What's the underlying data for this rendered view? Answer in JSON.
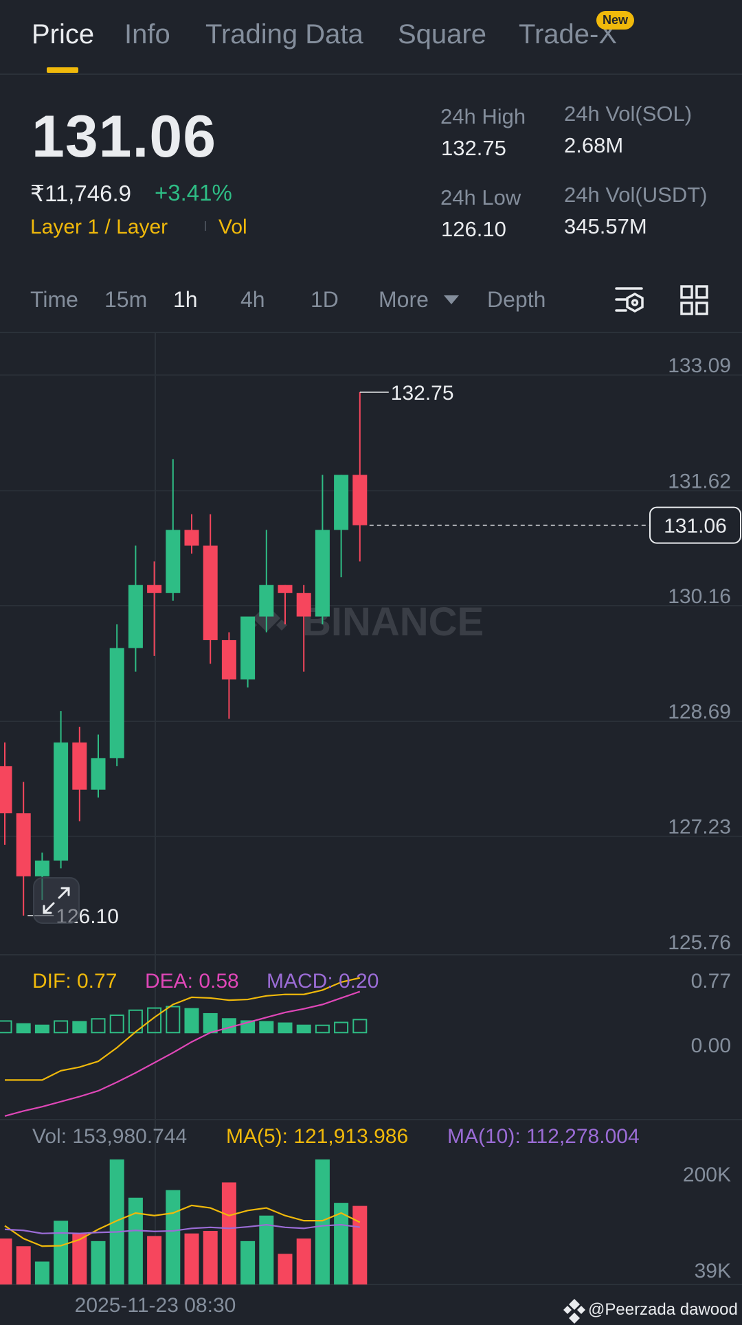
{
  "tabs": [
    {
      "label": "Price"
    },
    {
      "label": "Info"
    },
    {
      "label": "Trading Data"
    },
    {
      "label": "Square"
    },
    {
      "label": "Trade-X"
    }
  ],
  "tab_badge": "New",
  "header": {
    "last_price": "131.06",
    "fiat_price": "₹11,746.9",
    "change_pct": "+3.41%",
    "tag_primary": "Layer 1 / Layer",
    "tag_secondary": "Vol",
    "high_label": "24h High",
    "high_value": "132.75",
    "low_label": "24h Low",
    "low_value": "126.10",
    "vol_base_label": "24h Vol(SOL)",
    "vol_base_value": "2.68M",
    "vol_quote_label": "24h Vol(USDT)",
    "vol_quote_value": "345.57M"
  },
  "intervals": {
    "time": "Time",
    "m15": "15m",
    "h1": "1h",
    "h4": "4h",
    "d1": "1D",
    "more": "More",
    "depth": "Depth"
  },
  "icons": {
    "settings": "chart-settings-icon",
    "layout": "grid-layout-icon",
    "expand": "expand-icon",
    "brand": "binance-logo-icon"
  },
  "colors": {
    "up": "#2ebd85",
    "down": "#f6465d",
    "accent": "#f0b90b",
    "dea": "#e047b8",
    "ma10": "#9b6cd6"
  },
  "chart_data": {
    "type": "candlestick",
    "price_axis_ticks": [
      "133.09",
      "131.62",
      "130.16",
      "128.69",
      "127.23",
      "125.76"
    ],
    "price_ylim": [
      125.76,
      133.09
    ],
    "current_price_label": "131.06",
    "high_marker": "132.75",
    "low_marker": "126.10",
    "watermark": "BINANCE",
    "candles": [
      {
        "o": 128.0,
        "h": 128.3,
        "l": 127.0,
        "c": 127.4
      },
      {
        "o": 127.4,
        "h": 127.8,
        "l": 126.1,
        "c": 126.6
      },
      {
        "o": 126.6,
        "h": 126.9,
        "l": 126.3,
        "c": 126.8
      },
      {
        "o": 126.8,
        "h": 128.7,
        "l": 126.7,
        "c": 128.3
      },
      {
        "o": 128.3,
        "h": 128.5,
        "l": 127.3,
        "c": 127.7
      },
      {
        "o": 127.7,
        "h": 128.4,
        "l": 127.6,
        "c": 128.1
      },
      {
        "o": 128.1,
        "h": 129.8,
        "l": 128.0,
        "c": 129.5
      },
      {
        "o": 129.5,
        "h": 130.8,
        "l": 129.2,
        "c": 130.3
      },
      {
        "o": 130.3,
        "h": 130.6,
        "l": 129.4,
        "c": 130.2
      },
      {
        "o": 130.2,
        "h": 131.9,
        "l": 130.1,
        "c": 131.0
      },
      {
        "o": 131.0,
        "h": 131.2,
        "l": 130.7,
        "c": 130.8
      },
      {
        "o": 130.8,
        "h": 131.2,
        "l": 129.3,
        "c": 129.6
      },
      {
        "o": 129.6,
        "h": 129.7,
        "l": 128.6,
        "c": 129.1
      },
      {
        "o": 129.1,
        "h": 129.8,
        "l": 129.0,
        "c": 129.9
      },
      {
        "o": 129.9,
        "h": 131.0,
        "l": 129.7,
        "c": 130.3
      },
      {
        "o": 130.3,
        "h": 130.3,
        "l": 129.8,
        "c": 130.2
      },
      {
        "o": 130.2,
        "h": 130.3,
        "l": 129.2,
        "c": 129.9
      },
      {
        "o": 129.9,
        "h": 131.7,
        "l": 129.8,
        "c": 131.0
      },
      {
        "o": 131.0,
        "h": 131.7,
        "l": 130.4,
        "c": 131.7
      },
      {
        "o": 131.7,
        "h": 132.75,
        "l": 130.6,
        "c": 131.06
      }
    ],
    "macd": {
      "dif_label": "DIF: 0.77",
      "dea_label": "DEA: 0.58",
      "macd_label": "MACD: 0.20",
      "axis_ticks": [
        "0.77",
        "0.00"
      ],
      "ylim": [
        -1.2,
        0.9
      ],
      "histogram": [
        0.18,
        0.14,
        0.12,
        0.18,
        0.17,
        0.21,
        0.26,
        0.33,
        0.36,
        0.38,
        0.35,
        0.28,
        0.21,
        0.18,
        0.17,
        0.15,
        0.12,
        0.12,
        0.16,
        0.2
      ],
      "dif": [
        -0.65,
        -0.65,
        -0.65,
        -0.52,
        -0.47,
        -0.39,
        -0.2,
        0.02,
        0.22,
        0.4,
        0.5,
        0.49,
        0.46,
        0.47,
        0.52,
        0.54,
        0.54,
        0.6,
        0.71,
        0.77
      ],
      "dea": [
        -1.15,
        -1.08,
        -1.02,
        -0.95,
        -0.88,
        -0.8,
        -0.68,
        -0.55,
        -0.41,
        -0.27,
        -0.12,
        0.01,
        0.08,
        0.15,
        0.22,
        0.29,
        0.34,
        0.4,
        0.49,
        0.58
      ]
    },
    "volume": {
      "vol_label": "Vol: 153,980.744",
      "ma5_label": "MA(5): 121,913.986",
      "ma10_label": "MA(10): 112,278.004",
      "axis_ticks": [
        "200K",
        "39K"
      ],
      "ylim": [
        0,
        245000
      ],
      "values": [
        90000,
        75000,
        45000,
        125000,
        100000,
        85000,
        245000,
        170000,
        95000,
        185000,
        100000,
        105000,
        200000,
        85000,
        135000,
        60000,
        90000,
        245000,
        160000,
        154000
      ],
      "up": [
        false,
        false,
        true,
        true,
        false,
        true,
        true,
        true,
        false,
        true,
        false,
        false,
        false,
        true,
        true,
        false,
        false,
        true,
        true,
        false
      ],
      "ma5": [
        115000,
        90000,
        75000,
        76000,
        88000,
        108000,
        125000,
        140000,
        135000,
        140000,
        155000,
        150000,
        135000,
        145000,
        150000,
        135000,
        125000,
        125000,
        140000,
        121914
      ],
      "ma10": [
        108000,
        106000,
        100000,
        101000,
        100000,
        102000,
        103000,
        106000,
        104000,
        105000,
        110000,
        112000,
        110000,
        113000,
        117000,
        112000,
        110000,
        115000,
        117000,
        112278
      ]
    },
    "time_label": "2025-11-23 08:30",
    "credit": "@Peerzada dawood"
  }
}
